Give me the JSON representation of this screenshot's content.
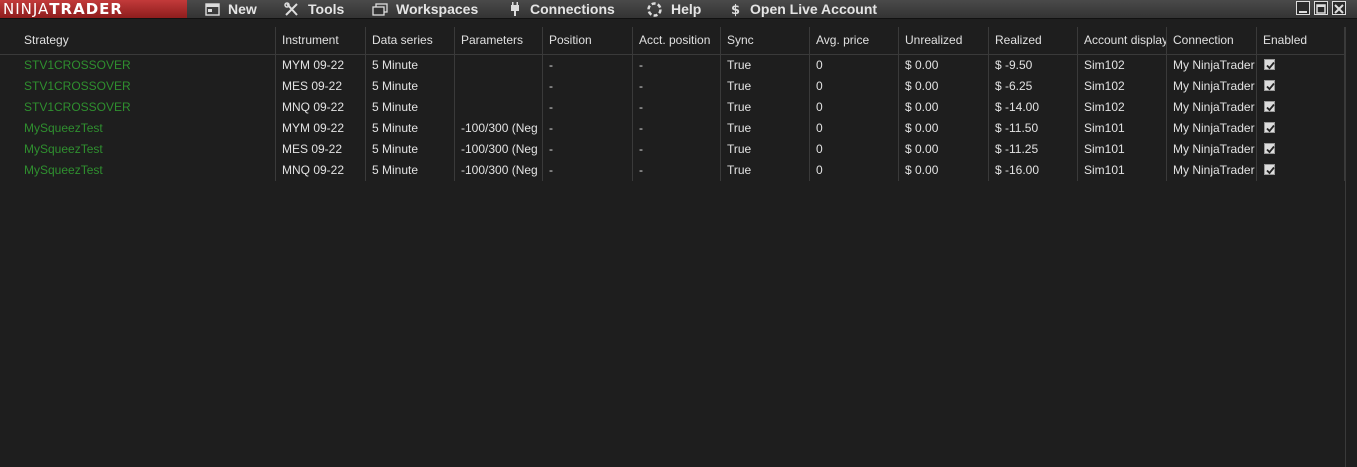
{
  "app": {
    "logo_a": "NINJA",
    "logo_b": "TRADER"
  },
  "menu": {
    "new": "New",
    "tools": "Tools",
    "workspaces": "Workspaces",
    "connections": "Connections",
    "help": "Help",
    "live": "Open Live Account"
  },
  "icons": [
    "new-window-icon",
    "tools-icon",
    "workspaces-icon",
    "connections-plug-icon",
    "help-lifebuoy-icon",
    "dollar-icon",
    "minimize-icon",
    "maximize-icon",
    "close-icon",
    "checkbox-checked-icon"
  ],
  "columns": [
    "Strategy",
    "Instrument",
    "Data series",
    "Parameters",
    "Position",
    "Acct. position",
    "Sync",
    "Avg. price",
    "Unrealized",
    "Realized",
    "Account display name",
    "Connection",
    "Enabled"
  ],
  "rows": [
    {
      "strategy": "STV1CROSSOVER",
      "instrument": "MYM 09-22",
      "data_series": "5 Minute",
      "parameters": "",
      "position": "-",
      "acct_position": "-",
      "sync": "True",
      "avg_price": "0",
      "unrealized": "$ 0.00",
      "realized": "$ -9.50",
      "account": "Sim102",
      "connection": "My NinjaTrader",
      "enabled": true
    },
    {
      "strategy": "STV1CROSSOVER",
      "instrument": "MES 09-22",
      "data_series": "5 Minute",
      "parameters": "",
      "position": "-",
      "acct_position": "-",
      "sync": "True",
      "avg_price": "0",
      "unrealized": "$ 0.00",
      "realized": "$ -6.25",
      "account": "Sim102",
      "connection": "My NinjaTrader",
      "enabled": true
    },
    {
      "strategy": "STV1CROSSOVER",
      "instrument": "MNQ 09-22",
      "data_series": "5 Minute",
      "parameters": "",
      "position": "-",
      "acct_position": "-",
      "sync": "True",
      "avg_price": "0",
      "unrealized": "$ 0.00",
      "realized": "$ -14.00",
      "account": "Sim102",
      "connection": "My NinjaTrader",
      "enabled": true
    },
    {
      "strategy": "MySqueezTest",
      "instrument": "MYM 09-22",
      "data_series": "5 Minute",
      "parameters": "-100/300 (Neg",
      "position": "-",
      "acct_position": "-",
      "sync": "True",
      "avg_price": "0",
      "unrealized": "$ 0.00",
      "realized": "$ -11.50",
      "account": "Sim101",
      "connection": "My NinjaTrader",
      "enabled": true
    },
    {
      "strategy": "MySqueezTest",
      "instrument": "MES 09-22",
      "data_series": "5 Minute",
      "parameters": "-100/300 (Neg",
      "position": "-",
      "acct_position": "-",
      "sync": "True",
      "avg_price": "0",
      "unrealized": "$ 0.00",
      "realized": "$ -11.25",
      "account": "Sim101",
      "connection": "My NinjaTrader",
      "enabled": true
    },
    {
      "strategy": "MySqueezTest",
      "instrument": "MNQ 09-22",
      "data_series": "5 Minute",
      "parameters": "-100/300 (Neg",
      "position": "-",
      "acct_position": "-",
      "sync": "True",
      "avg_price": "0",
      "unrealized": "$ 0.00",
      "realized": "$ -16.00",
      "account": "Sim101",
      "connection": "My NinjaTrader",
      "enabled": true
    }
  ]
}
